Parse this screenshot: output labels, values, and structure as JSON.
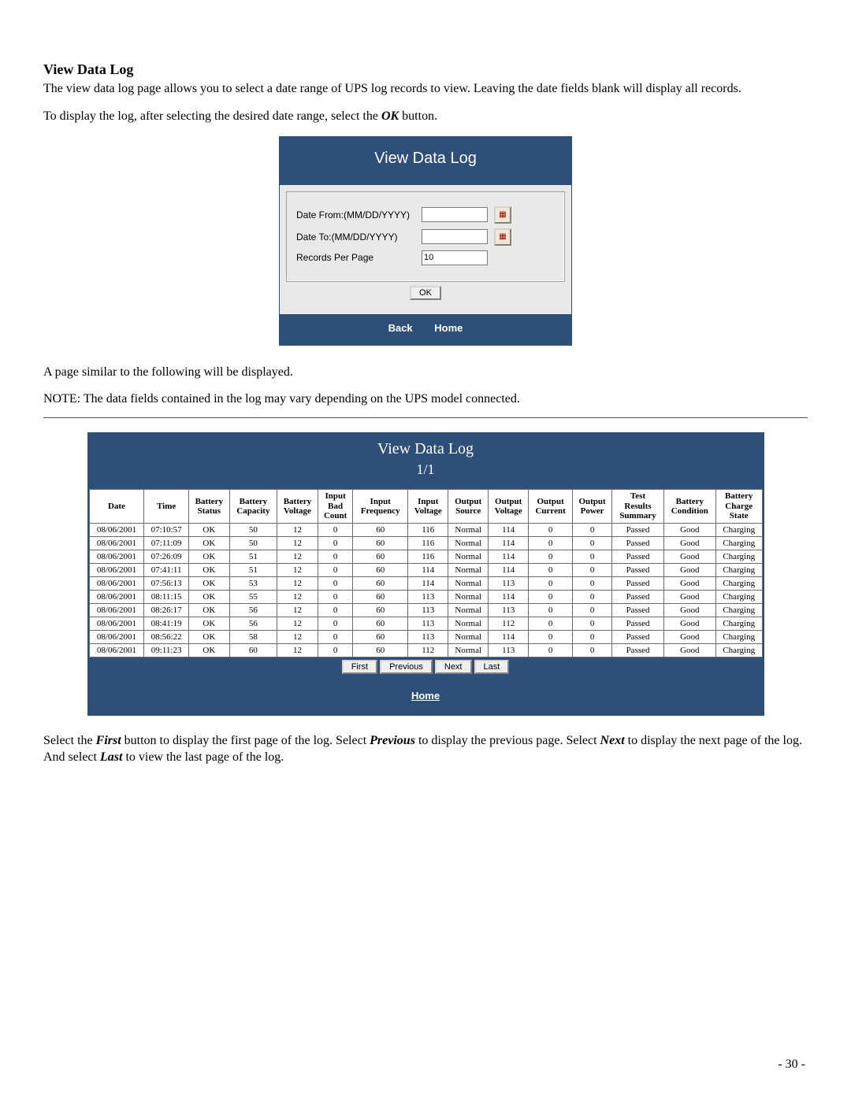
{
  "heading": "View Data Log",
  "intro_para": "The view data log page allows you to select a date range of UPS log records to view.  Leaving the date fields blank will display all records.",
  "instruction_prefix": "To display the log, after selecting the desired date range, select the ",
  "instruction_ok": "OK",
  "instruction_suffix": " button.",
  "form_panel": {
    "title": "View Data Log",
    "date_from_label": "Date From:(MM/DD/YYYY)",
    "date_to_label": "Date To:(MM/DD/YYYY)",
    "rpp_label": "Records Per Page",
    "rpp_value": "10",
    "ok_label": "OK",
    "back_label": "Back",
    "home_label": "Home"
  },
  "after_form_text": "A page similar to the following will be displayed.",
  "note_text": "NOTE: The data fields contained in the log may vary depending on the UPS model connected.",
  "results_panel": {
    "title": "View Data Log",
    "page_counter": "1/1",
    "first_label": "First",
    "prev_label": "Previous",
    "next_label": "Next",
    "last_label": "Last",
    "home_label": "Home",
    "columns": [
      "Date",
      "Time",
      "Battery Status",
      "Battery Capacity",
      "Battery Voltage",
      "Input Bad Count",
      "Input Frequency",
      "Input Voltage",
      "Output Source",
      "Output Voltage",
      "Output Current",
      "Output Power",
      "Test Results Summary",
      "Battery Condition",
      "Battery Charge State"
    ],
    "rows": [
      [
        "08/06/2001",
        "07:10:57",
        "OK",
        "50",
        "12",
        "0",
        "60",
        "116",
        "Normal",
        "114",
        "0",
        "0",
        "Passed",
        "Good",
        "Charging"
      ],
      [
        "08/06/2001",
        "07:11:09",
        "OK",
        "50",
        "12",
        "0",
        "60",
        "116",
        "Normal",
        "114",
        "0",
        "0",
        "Passed",
        "Good",
        "Charging"
      ],
      [
        "08/06/2001",
        "07:26:09",
        "OK",
        "51",
        "12",
        "0",
        "60",
        "116",
        "Normal",
        "114",
        "0",
        "0",
        "Passed",
        "Good",
        "Charging"
      ],
      [
        "08/06/2001",
        "07:41:11",
        "OK",
        "51",
        "12",
        "0",
        "60",
        "114",
        "Normal",
        "114",
        "0",
        "0",
        "Passed",
        "Good",
        "Charging"
      ],
      [
        "08/06/2001",
        "07:56:13",
        "OK",
        "53",
        "12",
        "0",
        "60",
        "114",
        "Normal",
        "113",
        "0",
        "0",
        "Passed",
        "Good",
        "Charging"
      ],
      [
        "08/06/2001",
        "08:11:15",
        "OK",
        "55",
        "12",
        "0",
        "60",
        "113",
        "Normal",
        "114",
        "0",
        "0",
        "Passed",
        "Good",
        "Charging"
      ],
      [
        "08/06/2001",
        "08:26:17",
        "OK",
        "56",
        "12",
        "0",
        "60",
        "113",
        "Normal",
        "113",
        "0",
        "0",
        "Passed",
        "Good",
        "Charging"
      ],
      [
        "08/06/2001",
        "08:41:19",
        "OK",
        "56",
        "12",
        "0",
        "60",
        "113",
        "Normal",
        "112",
        "0",
        "0",
        "Passed",
        "Good",
        "Charging"
      ],
      [
        "08/06/2001",
        "08:56:22",
        "OK",
        "58",
        "12",
        "0",
        "60",
        "113",
        "Normal",
        "114",
        "0",
        "0",
        "Passed",
        "Good",
        "Charging"
      ],
      [
        "08/06/2001",
        "09:11:23",
        "OK",
        "60",
        "12",
        "0",
        "60",
        "112",
        "Normal",
        "113",
        "0",
        "0",
        "Passed",
        "Good",
        "Charging"
      ]
    ]
  },
  "closing_segments": {
    "s1": "Select the ",
    "first": "First",
    "s2": " button to display the first page of the log.  Select ",
    "previous": "Previous",
    "s3": " to display the previous page.  Select ",
    "next": "Next",
    "s4": " to display the next page of the log.  And select ",
    "last": "Last",
    "s5": " to view the last page of the log."
  },
  "page_number": "- 30 -"
}
